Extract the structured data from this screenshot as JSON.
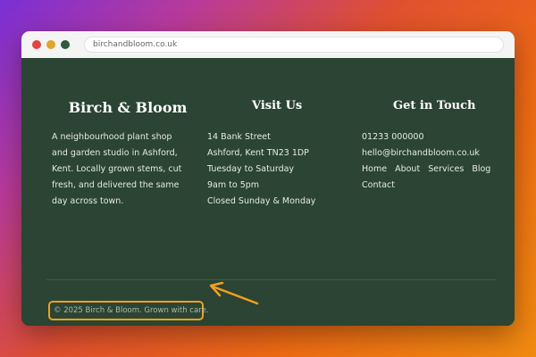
{
  "browser": {
    "url": "birchandbloom.co.uk"
  },
  "footer": {
    "brand": "Birch & Bloom",
    "about": "A neighbourhood plant shop and garden studio in Ashford, Kent. Locally grown stems, cut fresh, and delivered the same day across town.",
    "visit": {
      "heading": "Visit Us",
      "lines": [
        "14 Bank Street",
        "Ashford, Kent TN23 1DP",
        "Tuesday to Saturday",
        "9am to 5pm",
        "Closed Sunday & Monday"
      ]
    },
    "contact": {
      "heading": "Get in Touch",
      "phone": "01233 000000",
      "email": "hello@birchandbloom.co.uk",
      "links": [
        "Home",
        "About",
        "Services",
        "Blog",
        "Contact"
      ]
    },
    "copyright": "© 2025 Birch & Bloom. Grown with care."
  },
  "colors": {
    "footer_bg": "#2b4433",
    "highlight": "#f0a020"
  }
}
